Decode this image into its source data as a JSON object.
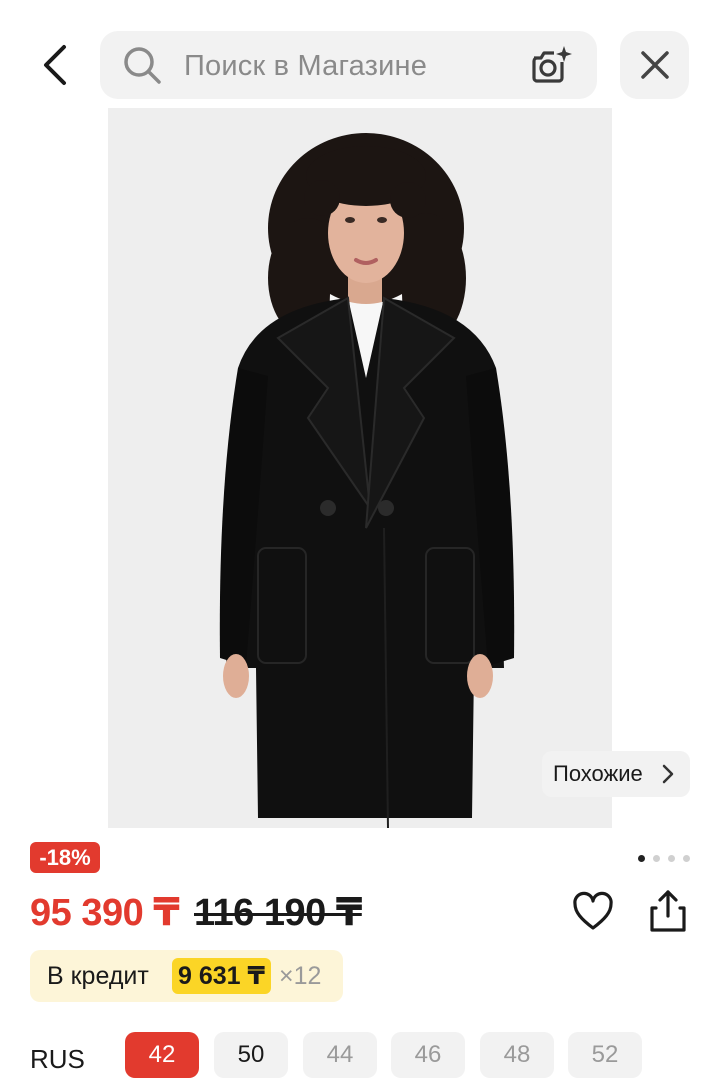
{
  "header": {
    "back_icon": "chevron-left-icon",
    "search_placeholder": "Поиск в Магазине",
    "search_icon": "search-icon",
    "camera_icon": "camera-sparkle-icon",
    "close_icon": "close-icon"
  },
  "gallery": {
    "similar_label": "Похожие",
    "dots_total": 4,
    "dots_active": 1
  },
  "product": {
    "discount": "-18%",
    "price_current": "95 390 ₸",
    "price_old": "116 190 ₸",
    "credit": {
      "label": "В кредит",
      "amount": "9 631 ₸",
      "multiplier": "×12"
    }
  },
  "sizes": {
    "system": "RUS",
    "items": [
      {
        "label": "42",
        "state": "selected"
      },
      {
        "label": "50",
        "state": "available"
      },
      {
        "label": "44",
        "state": "unavailable"
      },
      {
        "label": "46",
        "state": "unavailable"
      },
      {
        "label": "48",
        "state": "unavailable"
      },
      {
        "label": "52",
        "state": "unavailable"
      }
    ]
  },
  "colors": {
    "accent_red": "#e23a2e",
    "credit_bg": "#fdf5d8",
    "credit_highlight": "#fbd526"
  }
}
